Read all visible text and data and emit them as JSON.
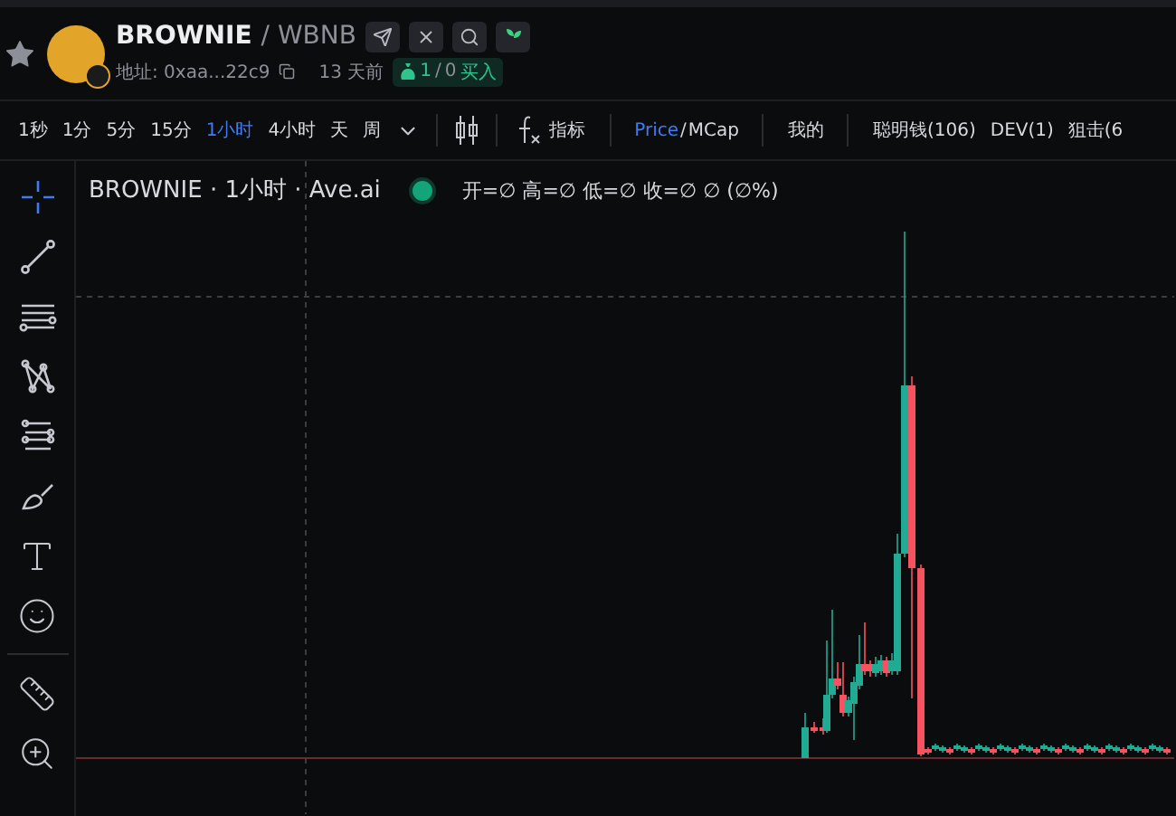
{
  "token": {
    "symbol": "BROWNIE",
    "pair": "/ WBNB",
    "address": "地址: 0xaa...22c9",
    "age": "13 天前",
    "buys": "1",
    "sells": "0",
    "buy_label": "买入",
    "trade_separator": "/",
    "favorite": false
  },
  "intervals": [
    {
      "label": "1秒",
      "selected": false
    },
    {
      "label": "1分",
      "selected": false
    },
    {
      "label": "5分",
      "selected": false
    },
    {
      "label": "15分",
      "selected": false
    },
    {
      "label": "1小时",
      "selected": true
    },
    {
      "label": "4小时",
      "selected": false
    },
    {
      "label": "天",
      "selected": false
    },
    {
      "label": "周",
      "selected": false
    }
  ],
  "indicators": "指标",
  "price_modes": [
    {
      "label": "Price",
      "selected": true
    },
    {
      "label": "MCap",
      "selected": false
    }
  ],
  "mode_separator": "/",
  "filters": [
    "我的",
    "聪明钱(106)",
    "DEV(1)",
    "狙击(6"
  ],
  "legend": {
    "title": "BROWNIE · 1小时 · Ave.ai",
    "ohlc": "开=∅ 高=∅ 低=∅ 收=∅ ∅ (∅%)"
  },
  "tool_groups": [
    [
      {
        "kind": "crosshair",
        "selected": true
      },
      {
        "kind": "line",
        "selected": false
      },
      {
        "kind": "hlines",
        "selected": false
      },
      {
        "kind": "pattern",
        "selected": false
      },
      {
        "kind": "fib",
        "selected": false
      },
      {
        "kind": "brush",
        "selected": false
      },
      {
        "kind": "text",
        "selected": false
      },
      {
        "kind": "emoji",
        "selected": false
      }
    ],
    [
      {
        "kind": "ruler",
        "selected": false
      },
      {
        "kind": "zoom",
        "selected": false
      }
    ]
  ]
}
